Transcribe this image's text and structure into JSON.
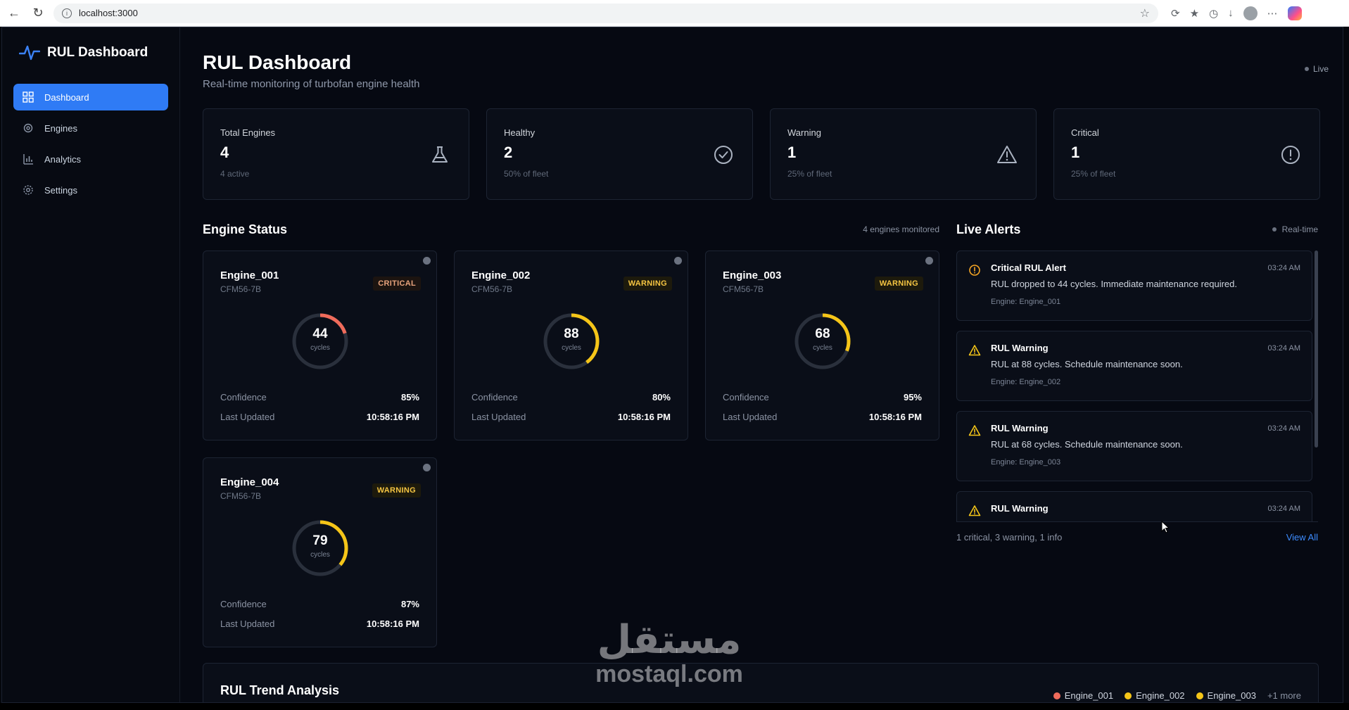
{
  "browser": {
    "url": "localhost:3000"
  },
  "brand": {
    "title": "RUL Dashboard"
  },
  "sidebar": {
    "items": [
      {
        "label": "Dashboard",
        "icon": "grid-icon",
        "active": true
      },
      {
        "label": "Engines",
        "icon": "gear-icon",
        "active": false
      },
      {
        "label": "Analytics",
        "icon": "bar-chart-icon",
        "active": false
      },
      {
        "label": "Settings",
        "icon": "settings-icon",
        "active": false
      }
    ]
  },
  "header": {
    "title": "RUL Dashboard",
    "subtitle": "Real-time monitoring of turbofan engine health",
    "live_label": "Live"
  },
  "stats": [
    {
      "label": "Total Engines",
      "value": "4",
      "sub": "4 active",
      "icon": "flask-icon"
    },
    {
      "label": "Healthy",
      "value": "2",
      "sub": "50% of fleet",
      "icon": "check-circle-icon"
    },
    {
      "label": "Warning",
      "value": "1",
      "sub": "25% of fleet",
      "icon": "warning-triangle-icon"
    },
    {
      "label": "Critical",
      "value": "1",
      "sub": "25% of fleet",
      "icon": "alert-circle-icon"
    }
  ],
  "engine_status": {
    "title": "Engine Status",
    "meta": "4 engines monitored",
    "confidence_label": "Confidence",
    "updated_label": "Last Updated",
    "unit": "cycles",
    "engines": [
      {
        "name": "Engine_001",
        "model": "CFM56-7B",
        "status": "CRITICAL",
        "rul": "44",
        "fill": 0.2,
        "color": "#ef6b5b",
        "confidence": "85%",
        "updated": "10:58:16 PM"
      },
      {
        "name": "Engine_002",
        "model": "CFM56-7B",
        "status": "WARNING",
        "rul": "88",
        "fill": 0.4,
        "color": "#f5c518",
        "confidence": "80%",
        "updated": "10:58:16 PM"
      },
      {
        "name": "Engine_003",
        "model": "CFM56-7B",
        "status": "WARNING",
        "rul": "68",
        "fill": 0.31,
        "color": "#f5c518",
        "confidence": "95%",
        "updated": "10:58:16 PM"
      },
      {
        "name": "Engine_004",
        "model": "CFM56-7B",
        "status": "WARNING",
        "rul": "79",
        "fill": 0.36,
        "color": "#f5c518",
        "confidence": "87%",
        "updated": "10:58:16 PM"
      }
    ]
  },
  "alerts": {
    "title": "Live Alerts",
    "meta": "Real-time",
    "items": [
      {
        "type": "critical",
        "title": "Critical RUL Alert",
        "message": "RUL dropped to 44 cycles. Immediate maintenance required.",
        "engine": "Engine: Engine_001",
        "time": "03:24 AM"
      },
      {
        "type": "warning",
        "title": "RUL Warning",
        "message": "RUL at 88 cycles. Schedule maintenance soon.",
        "engine": "Engine: Engine_002",
        "time": "03:24 AM"
      },
      {
        "type": "warning",
        "title": "RUL Warning",
        "message": "RUL at 68 cycles. Schedule maintenance soon.",
        "engine": "Engine: Engine_003",
        "time": "03:24 AM"
      },
      {
        "type": "warning",
        "title": "RUL Warning",
        "message": "",
        "engine": "",
        "time": "03:24 AM"
      }
    ],
    "summary": "1 critical, 3 warning, 1 info",
    "view_all": "View All"
  },
  "trend": {
    "title": "RUL Trend Analysis",
    "legend": [
      {
        "label": "Engine_001",
        "color": "#ef6b5b"
      },
      {
        "label": "Engine_002",
        "color": "#f5c518"
      },
      {
        "label": "Engine_003",
        "color": "#f5c518"
      }
    ],
    "more": "+1 more"
  },
  "watermark": {
    "arabic": "مستقل",
    "latin": "mostaql.com"
  },
  "colors": {
    "accent": "#2f7bf5",
    "critical": "#ef6b5b",
    "warning": "#f5c518",
    "background": "#060912"
  }
}
